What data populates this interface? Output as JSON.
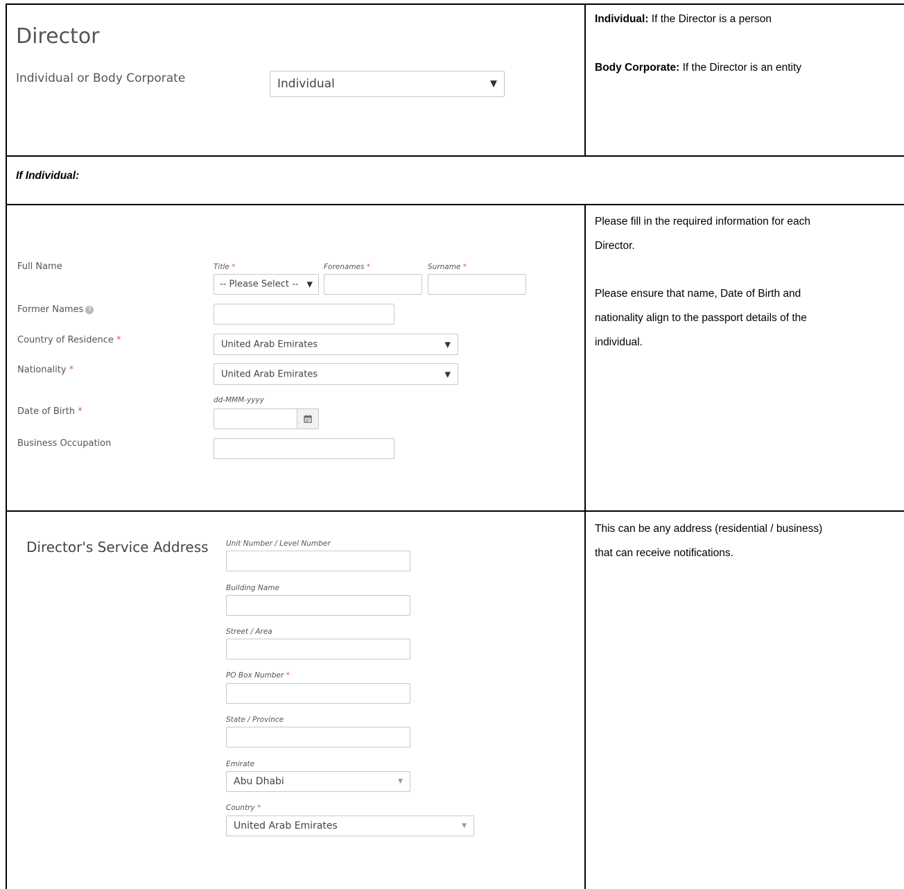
{
  "top": {
    "heading": "Director",
    "type_label": "Individual or Body Corporate",
    "type_value": "Individual",
    "note_individual_bold": "Individual:",
    "note_individual_text": " If the Director is a person",
    "note_body_bold": "Body Corporate:",
    "note_body_text": " If the Director is an entity"
  },
  "if_individual": "If Individual:",
  "personal": {
    "full_name_label": "Full Name",
    "title_label": "Title",
    "forenames_label": "Forenames",
    "surname_label": "Surname",
    "required_mark": "*",
    "title_value": "-- Please Select --",
    "former_names_label": "Former Names",
    "country_residence_label": "Country of Residence",
    "country_residence_value": "United Arab Emirates",
    "nationality_label": "Nationality",
    "nationality_value": "United Arab Emirates",
    "dob_label": "Date of Birth",
    "dob_format": "dd-MMM-yyyy",
    "occupation_label": "Business Occupation",
    "note_line1": "Please fill in the required information for each",
    "note_line2": "Director.",
    "note_line3": "Please ensure that name, Date of Birth and",
    "note_line4": "nationality align to the passport details of the",
    "note_line5": "individual."
  },
  "address": {
    "heading": "Director's Service Address",
    "unit_label": "Unit Number / Level Number",
    "building_label": "Building Name",
    "street_label": "Street / Area",
    "po_box_label": "PO Box Number",
    "state_label": "State / Province",
    "emirate_label": "Emirate",
    "emirate_value": "Abu Dhabi",
    "country_label": "Country",
    "country_value": "United Arab Emirates",
    "note_line1": "This can be any address (residential / business)",
    "note_line2": "that can receive notifications."
  },
  "icons": {
    "help": "question-circle-icon",
    "calendar": "calendar-icon",
    "dropdown": "caret-down-icon"
  },
  "colors": {
    "required": "#e2574c",
    "border": "#000000",
    "input_border": "#c8c8c8"
  }
}
